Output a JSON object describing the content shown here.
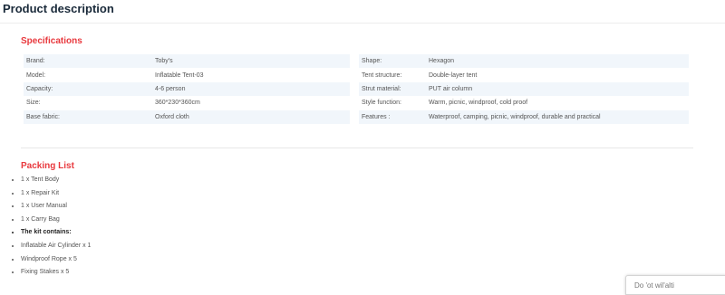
{
  "page_title": "Product description",
  "specifications": {
    "heading": "Specifications",
    "rows": [
      {
        "k1": "Brand:",
        "v1": "Toby's",
        "k2": "Shape:",
        "v2": "Hexagon"
      },
      {
        "k1": "Model:",
        "v1": "Inflatable Tent-03",
        "k2": "Tent structure:",
        "v2": "Double-layer tent"
      },
      {
        "k1": "Capacity:",
        "v1": "4-6 person",
        "k2": "Strut material:",
        "v2": "PUT air column"
      },
      {
        "k1": "Size:",
        "v1": "360*230*360cm",
        "k2": "Style function:",
        "v2": "Warm, picnic, windproof, cold proof"
      },
      {
        "k1": "Base fabric:",
        "v1": "Oxford cloth",
        "k2": "Features :",
        "v2": "Waterproof, camping, picnic, windproof, durable and practical"
      }
    ]
  },
  "packing_list": {
    "heading": "Packing List",
    "items": [
      "1 x Tent Body",
      "1 x Repair Kit",
      "1 x User Manual",
      "1 x Carry Bag",
      "The kit contains:",
      "Inflatable Air Cylinder x 1",
      "Windproof Rope x 5",
      "Fixing Stakes x 5"
    ]
  },
  "corner_widget": {
    "label": "Do 'ot wil'alti"
  },
  "colors": {
    "heading_red": "#e8383d",
    "row_shade": "#f1f6fb",
    "title": "#1a2a3a"
  }
}
